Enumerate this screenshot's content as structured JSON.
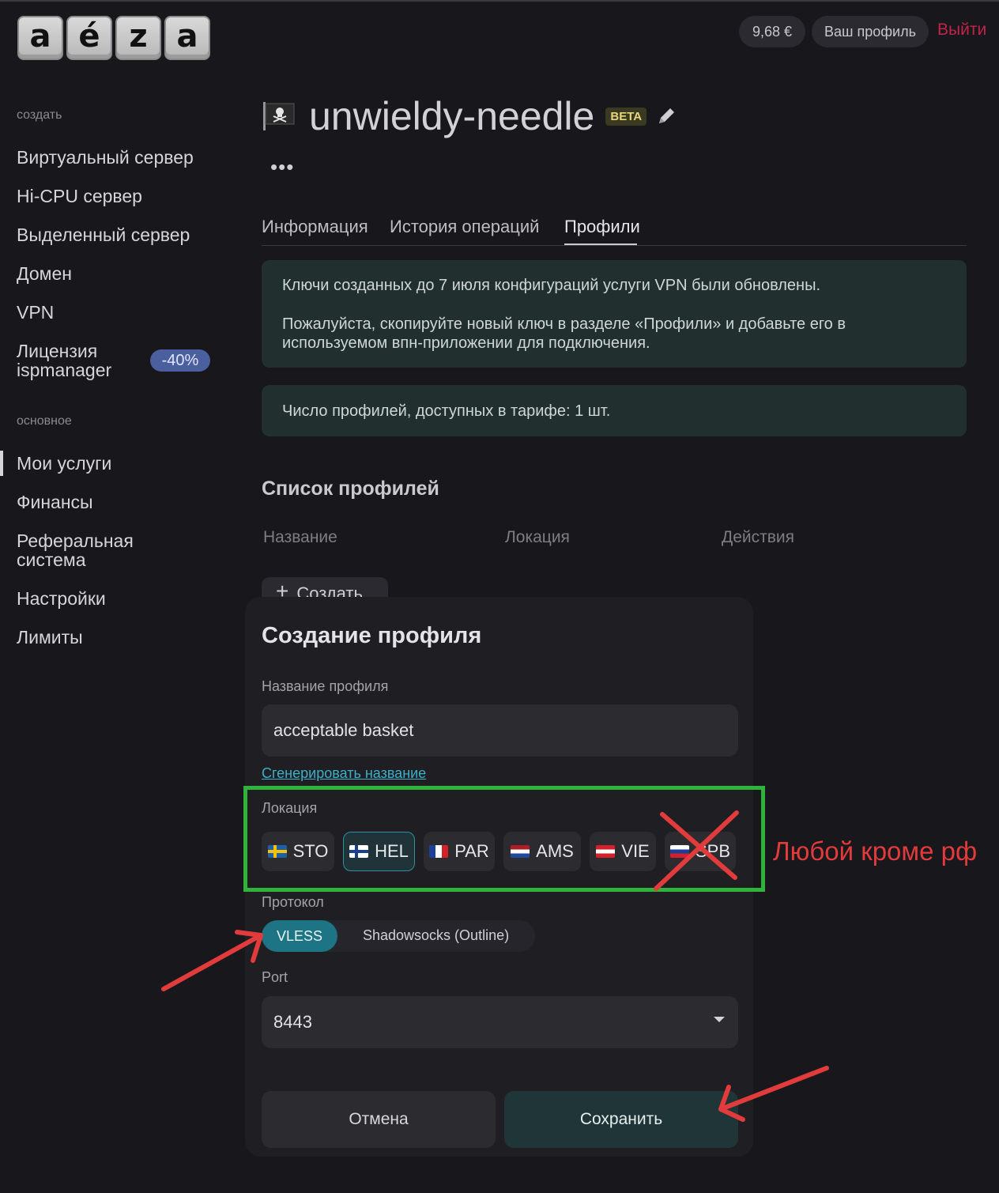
{
  "logo": {
    "letters": [
      "a",
      "é",
      "z",
      "a"
    ]
  },
  "header": {
    "balance": "9,68 €",
    "profile": "Ваш профиль",
    "logout": "Выйти"
  },
  "sidebar": {
    "section_create": "создать",
    "create_items": [
      "Виртуальный сервер",
      "Hi-CPU сервер",
      "Выделенный сервер",
      "Домен",
      "VPN"
    ],
    "license_line1": "Лицензия",
    "license_line2": "ispmanager",
    "license_badge": "-40%",
    "section_main": "основное",
    "main_items": [
      "Мои услуги",
      "Финансы"
    ],
    "referral_line1": "Реферальная",
    "referral_line2": "система",
    "main_items_2": [
      "Настройки",
      "Лимиты"
    ]
  },
  "service": {
    "name": "unwieldy-needle",
    "badge": "BETA",
    "menu": "•••",
    "icon": "pirate-flag-icon"
  },
  "tabs": [
    "Информация",
    "История операций",
    "Профили"
  ],
  "notices": {
    "update_line1": "Ключи созданных до 7 июля конфигураций услуги VPN были обновлены.",
    "update_line2": "Пожалуйста, скопируйте новый ключ в разделе «Профили» и добавьте его в используемом впн-приложении для подключения.",
    "limit": "Число профилей, доступных в тарифе: 1 шт."
  },
  "profiles": {
    "title": "Список профилей",
    "columns": [
      "Название",
      "Локация",
      "Действия"
    ],
    "create_label": "Создать"
  },
  "modal": {
    "title": "Создание профиля",
    "name_label": "Название профиля",
    "name_value": "acceptable basket",
    "generate_link": "Сгенерировать название",
    "location_label": "Локация",
    "locations": [
      {
        "code": "STO",
        "flag": "sweden-flag-icon"
      },
      {
        "code": "HEL",
        "flag": "finland-flag-icon",
        "selected": true
      },
      {
        "code": "PAR",
        "flag": "france-flag-icon"
      },
      {
        "code": "AMS",
        "flag": "netherlands-flag-icon"
      },
      {
        "code": "VIE",
        "flag": "austria-flag-icon"
      },
      {
        "code": "SPB",
        "flag": "russia-flag-icon"
      }
    ],
    "protocol_label": "Протокол",
    "protocols": [
      "VLESS",
      "Shadowsocks (Outline)"
    ],
    "port_label": "Port",
    "port_value": "8443",
    "cancel": "Отмена",
    "save": "Сохранить"
  },
  "annotation": {
    "text": "Любой кроме рф"
  },
  "colors": {
    "accent": "#1c7485",
    "link": "#3cb0c8",
    "logout": "#c0254a",
    "annotation_red": "#e23b3b",
    "annotation_green": "#2fb33b"
  }
}
